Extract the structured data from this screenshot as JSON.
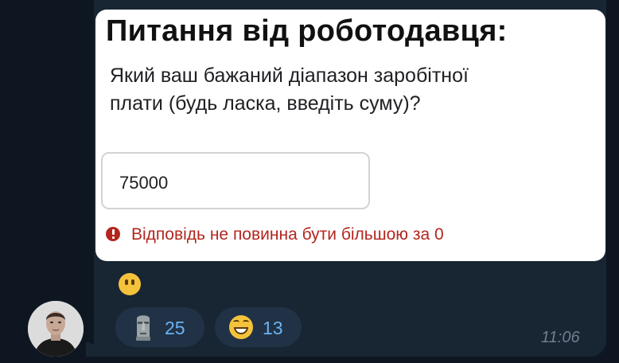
{
  "form_card": {
    "title": "Питання від роботодавця:",
    "question": "Який ваш бажаний діапазон заробітної плати (будь ласка, введіть суму)?",
    "answer_value": "75000",
    "error_text": "Відповідь не повинна бути більшою за 0",
    "error_color": "#b3261e"
  },
  "message": {
    "caption_emoji": "face-without-mouth-emoji",
    "time": "11:06"
  },
  "reactions": [
    {
      "emoji": "moai-emoji",
      "count": "25"
    },
    {
      "emoji": "grinning-face-emoji",
      "count": "13"
    }
  ],
  "theme": {
    "background": "#0e1621",
    "bubble": "#182533",
    "reaction_bg": "#213246",
    "reaction_count": "#6ab3f3"
  }
}
